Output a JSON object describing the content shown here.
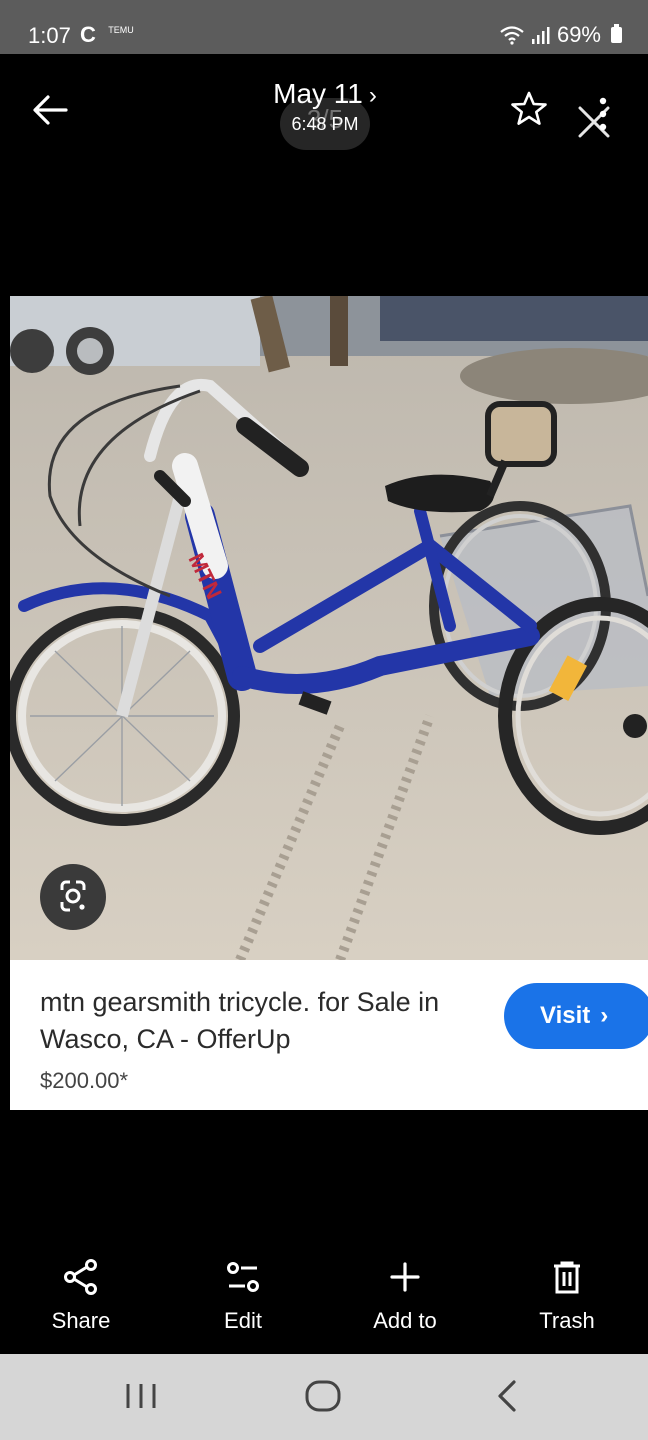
{
  "status_bar": {
    "time": "1:07",
    "c_icon_label": "C",
    "temu_label": "TEMU",
    "battery": "69%"
  },
  "header": {
    "date": "May 11",
    "time": "6:48 PM",
    "counter": "3/5"
  },
  "result": {
    "title": "mtn gearsmith tricycle. for Sale in Wasco, CA - OfferUp",
    "price": "$200.00*",
    "visit_label": "Visit"
  },
  "actions": [
    {
      "label": "Share",
      "icon": "share-icon"
    },
    {
      "label": "Edit",
      "icon": "edit-sliders-icon"
    },
    {
      "label": "Add to",
      "icon": "plus-icon"
    },
    {
      "label": "Trash",
      "icon": "trash-icon"
    }
  ],
  "colors": {
    "accent": "#1a73e8",
    "bike_blue": "#2336a8"
  }
}
